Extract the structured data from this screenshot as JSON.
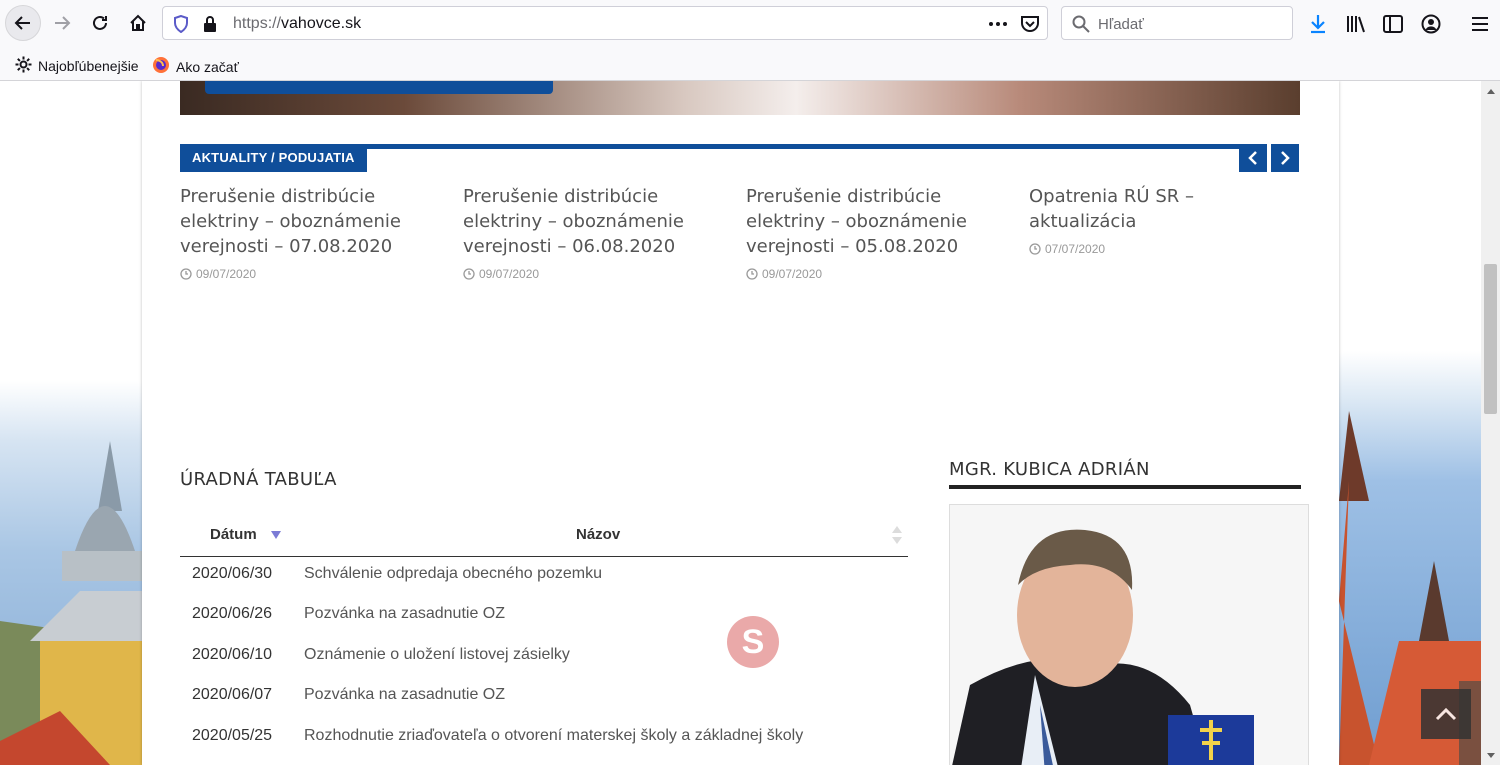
{
  "browser": {
    "url_scheme": "https://",
    "url_host": "vahovce.sk",
    "search_placeholder": "Hľadať",
    "bookmarks": [
      {
        "label": "Najobľúbenejšie",
        "icon": "gear-icon"
      },
      {
        "label": "Ako začať",
        "icon": "firefox-icon"
      }
    ]
  },
  "news": {
    "section_label": "AKTUALITY / PODUJATIA",
    "items": [
      {
        "title": "Prerušenie distribúcie elektriny – oboznámenie verejnosti – 07.08.2020",
        "date": "09/07/2020"
      },
      {
        "title": "Prerušenie distribúcie elektriny – oboznámenie verejnosti – 06.08.2020",
        "date": "09/07/2020"
      },
      {
        "title": "Prerušenie distribúcie elektriny – oboznámenie verejnosti – 05.08.2020",
        "date": "09/07/2020"
      },
      {
        "title": "Opatrenia RÚ SR – aktualizácia",
        "date": "07/07/2020"
      }
    ]
  },
  "board": {
    "title": "ÚRADNÁ TABUĽA",
    "columns": [
      "Dátum",
      "Názov"
    ],
    "rows": [
      {
        "date": "2020/06/30",
        "name": "Schválenie odpredaja obecného pozemku"
      },
      {
        "date": "2020/06/26",
        "name": "Pozvánka na zasadnutie OZ"
      },
      {
        "date": "2020/06/10",
        "name": "Oznámenie o uložení listovej zásielky"
      },
      {
        "date": "2020/06/07",
        "name": "Pozvánka na zasadnutie OZ"
      },
      {
        "date": "2020/05/25",
        "name": "Rozhodnutie zriaďovateľa o otvorení materskej školy a základnej školy"
      }
    ]
  },
  "sidebar": {
    "title": "MGR. KUBICA ADRIÁN"
  },
  "colors": {
    "accent": "#0f4e9a",
    "text": "#555555"
  }
}
